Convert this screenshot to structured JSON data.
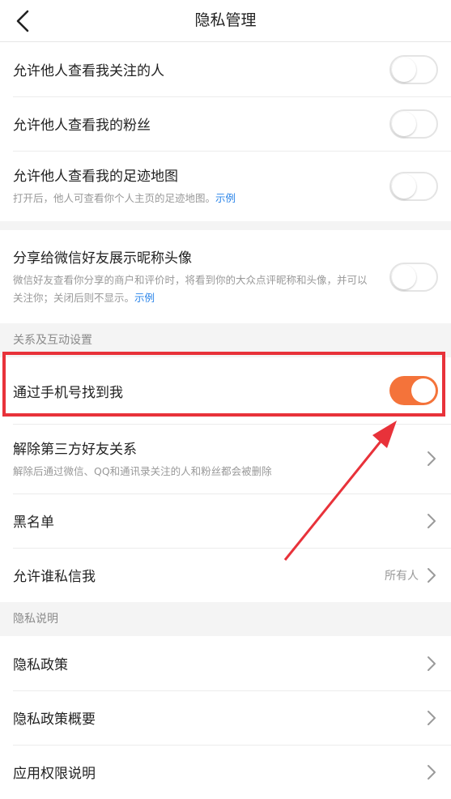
{
  "header": {
    "title": "隐私管理",
    "back_icon": "chevron-left-icon"
  },
  "group1": [
    {
      "label": "允许他人查看我关注的人",
      "toggle": "off"
    },
    {
      "label": "允许他人查看我的粉丝",
      "toggle": "off"
    },
    {
      "label": "允许他人查看我的足迹地图",
      "sub": "打开后，他人可查看你个人主页的足迹地图。",
      "link": "示例",
      "toggle": "off"
    }
  ],
  "group2": [
    {
      "label": "分享给微信好友展示昵称头像",
      "sub": "微信好友查看你分享的商户和评价时，将看到你的大众点评昵称和头像，并可以关注你；关闭后则不显示。",
      "link": "示例",
      "toggle": "off"
    }
  ],
  "section_relation": {
    "title": "关系及互动设置"
  },
  "group3": {
    "find_by_phone": {
      "label": "通过手机号找到我",
      "toggle": "on"
    },
    "remove_third_party": {
      "label": "解除第三方好友关系",
      "sub": "解除后通过微信、QQ和通讯录关注的人和粉丝都会被删除"
    },
    "blacklist": {
      "label": "黑名单"
    },
    "allow_dm": {
      "label": "允许谁私信我",
      "value": "所有人"
    }
  },
  "section_privacy": {
    "title": "隐私说明"
  },
  "group4": [
    {
      "label": "隐私政策"
    },
    {
      "label": "隐私政策概要"
    },
    {
      "label": "应用权限说明"
    }
  ],
  "colors": {
    "accent_toggle": "#f4733a",
    "highlight": "#e8323a",
    "link": "#2a84e9"
  }
}
